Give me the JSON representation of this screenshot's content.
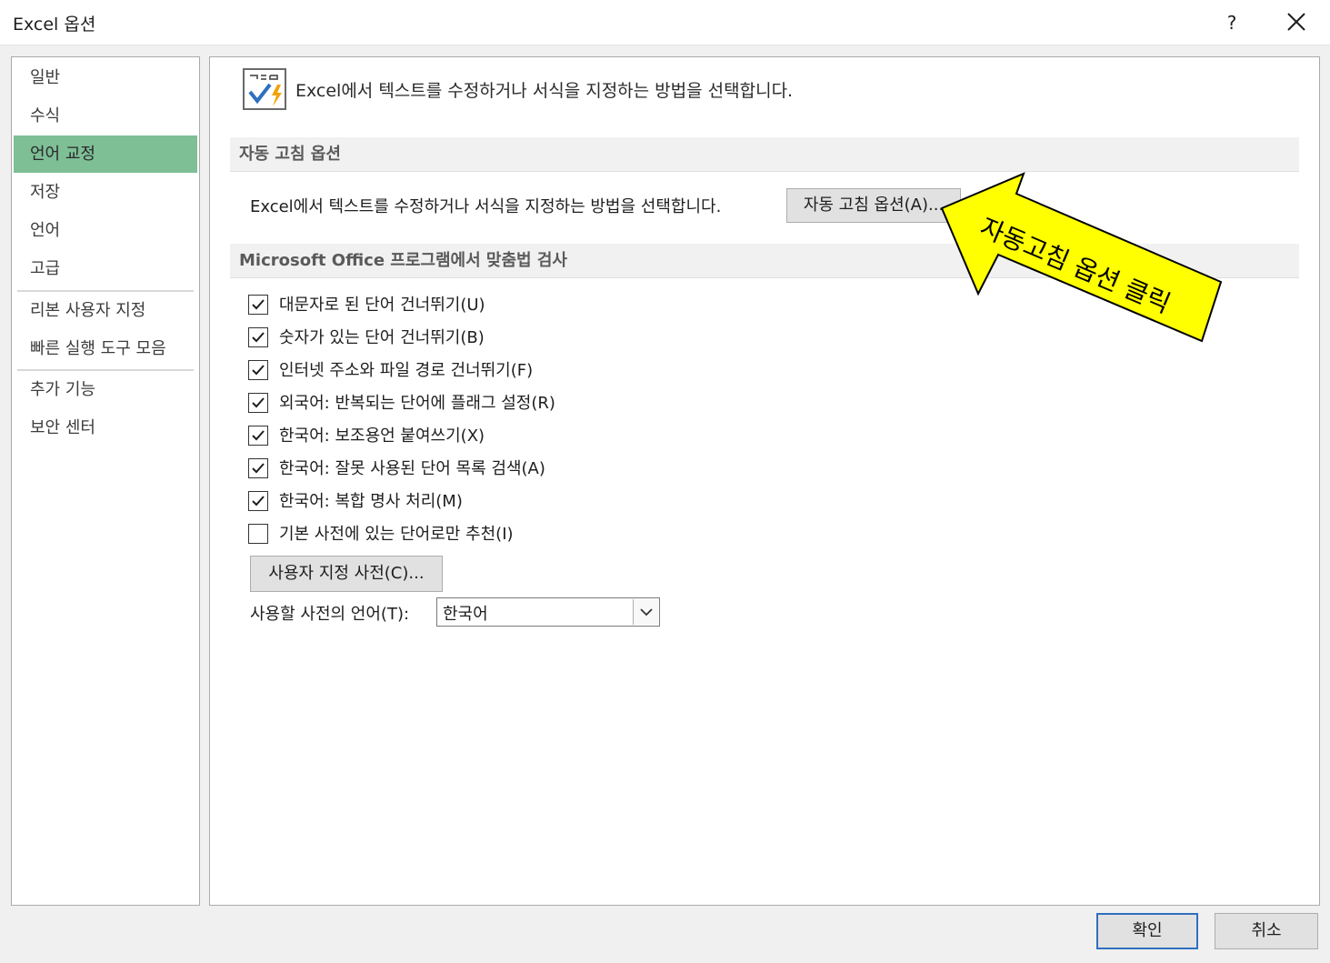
{
  "window": {
    "title": "Excel 옵션",
    "help_label": "?",
    "close_label": "✕"
  },
  "sidebar": {
    "items": [
      {
        "label": "일반",
        "active": false
      },
      {
        "label": "수식",
        "active": false
      },
      {
        "label": "언어 교정",
        "active": true
      },
      {
        "label": "저장",
        "active": false
      },
      {
        "label": "언어",
        "active": false
      },
      {
        "label": "고급",
        "active": false
      },
      {
        "label": "리본 사용자 지정",
        "active": false
      },
      {
        "label": "빠른 실행 도구 모음",
        "active": false
      },
      {
        "label": "추가 기능",
        "active": false
      },
      {
        "label": "보안 센터",
        "active": false
      }
    ],
    "active_color": "#7ebf96"
  },
  "main": {
    "header_text": "Excel에서 텍스트를 수정하거나 서식을 지정하는 방법을 선택합니다.",
    "autocorrect_section": {
      "title": "자동 고침 옵션",
      "description": "Excel에서 텍스트를 수정하거나 서식을 지정하는 방법을 선택합니다.",
      "button_label": "자동 고침 옵션(A)..."
    },
    "spelling_section": {
      "title": "Microsoft Office 프로그램에서 맞춤법 검사",
      "options": [
        {
          "label": "대문자로 된 단어 건너뛰기(U)",
          "checked": true
        },
        {
          "label": "숫자가 있는 단어 건너뛰기(B)",
          "checked": true
        },
        {
          "label": "인터넷 주소와 파일 경로 건너뛰기(F)",
          "checked": true
        },
        {
          "label": "외국어: 반복되는 단어에 플래그 설정(R)",
          "checked": true
        },
        {
          "label": "한국어: 보조용언 붙여쓰기(X)",
          "checked": true
        },
        {
          "label": "한국어: 잘못 사용된 단어 목록 검색(A)",
          "checked": true
        },
        {
          "label": "한국어: 복합 명사 처리(M)",
          "checked": true
        },
        {
          "label": "기본 사전에 있는 단어로만 추천(I)",
          "checked": false
        }
      ],
      "custom_dict_button": "사용자 지정 사전(C)...",
      "dictionary_language_label": "사용할 사전의 언어(T):",
      "dictionary_language_value": "한국어"
    }
  },
  "footer": {
    "ok_label": "확인",
    "cancel_label": "취소"
  },
  "annotation": {
    "text": "자동고침 옵션 클릭",
    "fill_color": "#ffff00"
  }
}
